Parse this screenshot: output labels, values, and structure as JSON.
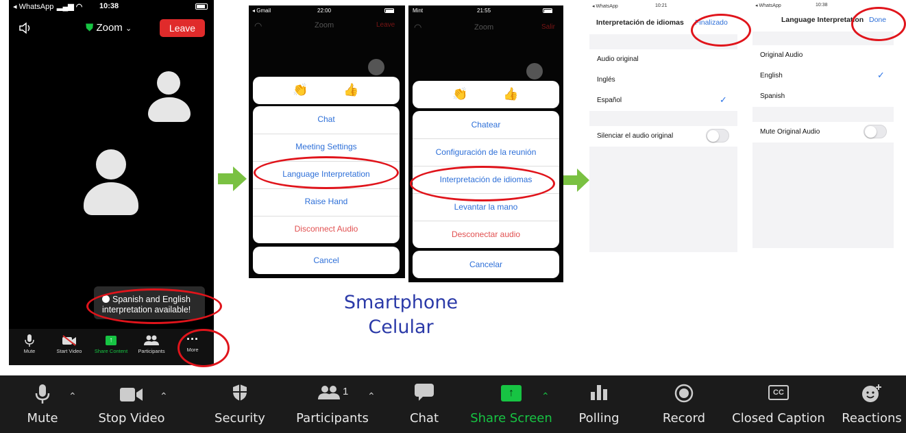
{
  "phone1": {
    "status": {
      "carrier": "◂ WhatsApp",
      "time": "10:38"
    },
    "meeting_name": "Zoom",
    "leave_label": "Leave",
    "toast": "Spanish and English interpretation available!",
    "toolbar": [
      {
        "label": "Mute"
      },
      {
        "label": "Start Video"
      },
      {
        "label": "Share Content"
      },
      {
        "label": "Participants"
      },
      {
        "label": "More"
      }
    ],
    "more_glyph": "···"
  },
  "phone2": {
    "status": {
      "carrier": "◂ Gmail",
      "time": "22:00"
    },
    "meeting_name": "Zoom",
    "leave_label": "Leave",
    "menu": [
      "Chat",
      "Meeting Settings",
      "Language Interpretation",
      "Raise Hand",
      "Disconnect Audio"
    ],
    "cancel_label": "Cancel"
  },
  "phone3": {
    "status": {
      "carrier": "Mint",
      "time": "21:55"
    },
    "meeting_name": "Zoom",
    "leave_label": "Salir",
    "menu": [
      "Chatear",
      "Configuración de la reunión",
      "Interpretación de idiomas",
      "Levantar la mano",
      "Desconectar audio"
    ],
    "cancel_label": "Cancelar"
  },
  "caption": {
    "line1": "Smartphone",
    "line2": "Celular"
  },
  "settings_es": {
    "status": {
      "carrier": "◂ WhatsApp",
      "time": "10:21"
    },
    "title": "Interpretación de idiomas",
    "done": "Finalizado",
    "options": [
      "Audio original",
      "Inglés",
      "Español"
    ],
    "mute_label": "Silenciar el audio original"
  },
  "settings_en": {
    "status": {
      "carrier": "◂ WhatsApp",
      "time": "10:38"
    },
    "title": "Language Interpretation",
    "done": "Done",
    "options": [
      "Original Audio",
      "English",
      "Spanish"
    ],
    "mute_label": "Mute Original Audio"
  },
  "desktop_toolbar": {
    "items": [
      {
        "label": "Mute",
        "icon": "microphone-icon"
      },
      {
        "label": "Stop Video",
        "icon": "video-camera-icon"
      },
      {
        "label": "Security",
        "icon": "shield-icon"
      },
      {
        "label": "Participants",
        "icon": "participants-icon",
        "count": "1"
      },
      {
        "label": "Chat",
        "icon": "chat-bubble-icon"
      },
      {
        "label": "Share Screen",
        "icon": "share-screen-icon"
      },
      {
        "label": "Polling",
        "icon": "poll-bars-icon"
      },
      {
        "label": "Record",
        "icon": "record-icon"
      },
      {
        "label": "Closed Caption",
        "icon": "cc-icon",
        "badge": "CC"
      },
      {
        "label": "Reactions",
        "icon": "reactions-icon"
      }
    ]
  },
  "colors": {
    "green": "#17c443",
    "red_button": "#e02b2b",
    "link_blue": "#2d6fd8",
    "annotation_red": "#e0141b",
    "caption_blue": "#2b3aa8",
    "arrow_green": "#7ac142"
  }
}
